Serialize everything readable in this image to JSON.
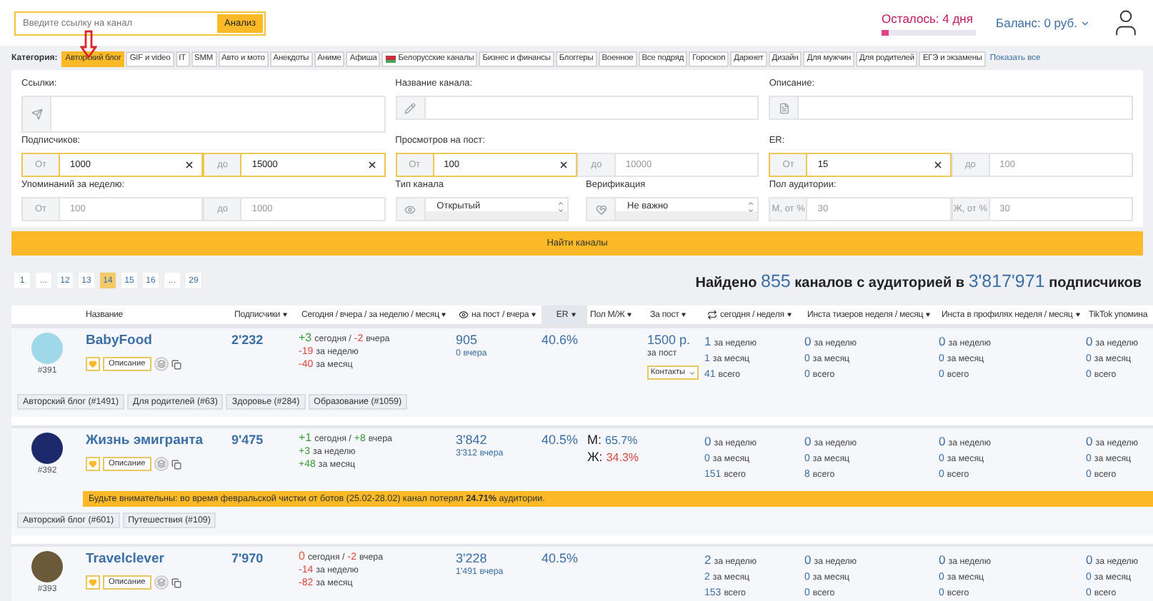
{
  "search": {
    "placeholder": "Введите ссылку на канал",
    "button": "Анализ"
  },
  "trial": {
    "label": "Осталось: 4 дня",
    "level": 0.08
  },
  "balance": {
    "label": "Баланс: 0 руб."
  },
  "categories": {
    "label": "Категория:",
    "show_all": "Показать все",
    "items": [
      {
        "label": "Авторский блог",
        "selected": true,
        "kind": "plain"
      },
      {
        "label": "GIF и video",
        "selected": false,
        "kind": "plain"
      },
      {
        "label": "IT",
        "selected": false,
        "kind": "plain"
      },
      {
        "label": "SMM",
        "selected": false,
        "kind": "plain"
      },
      {
        "label": "Авто и мото",
        "selected": false,
        "kind": "plain"
      },
      {
        "label": "Анекдоты",
        "selected": false,
        "kind": "plain"
      },
      {
        "label": "Аниме",
        "selected": false,
        "kind": "plain"
      },
      {
        "label": "Афиша",
        "selected": false,
        "kind": "plain"
      },
      {
        "label": "Белорусские каналы",
        "selected": false,
        "kind": "flag"
      },
      {
        "label": "Бизнес и финансы",
        "selected": false,
        "kind": "plain"
      },
      {
        "label": "Блоггеры",
        "selected": false,
        "kind": "plain"
      },
      {
        "label": "Военное",
        "selected": false,
        "kind": "plain"
      },
      {
        "label": "Все подряд",
        "selected": false,
        "kind": "plain"
      },
      {
        "label": "Гороскоп",
        "selected": false,
        "kind": "plain"
      },
      {
        "label": "Даркнет",
        "selected": false,
        "kind": "plain"
      },
      {
        "label": "Дизайн",
        "selected": false,
        "kind": "plain"
      },
      {
        "label": "Для мужчин",
        "selected": false,
        "kind": "plain"
      },
      {
        "label": "Для родителей",
        "selected": false,
        "kind": "plain"
      },
      {
        "label": "ЕГЭ и экзамены",
        "selected": false,
        "kind": "plain"
      }
    ]
  },
  "filters": {
    "links": {
      "label": "Ссылки:"
    },
    "channel_name": {
      "label": "Название канала:"
    },
    "description": {
      "label": "Описание:"
    },
    "subscribers": {
      "label": "Подписчиков:",
      "from": {
        "prefix": "От",
        "value": "1000"
      },
      "to": {
        "prefix": "до",
        "value": "15000"
      }
    },
    "views_per_post": {
      "label": "Просмотров на пост:",
      "from": {
        "prefix": "От",
        "value": "100"
      },
      "to": {
        "prefix": "до",
        "placeholder": "10000"
      }
    },
    "er": {
      "label": "ER:",
      "from": {
        "prefix": "От",
        "value": "15"
      },
      "to": {
        "prefix": "до",
        "placeholder": "100"
      }
    },
    "mentions": {
      "label": "Упоминаний за неделю:",
      "from": {
        "prefix": "От",
        "placeholder": "100"
      },
      "to": {
        "prefix": "до",
        "placeholder": "1000"
      }
    },
    "channel_type": {
      "label": "Тип канала",
      "value": "Открытый"
    },
    "verification": {
      "label": "Верификация",
      "value": "Не важно"
    },
    "audience_gender": {
      "label": "Пол аудитории:",
      "from": {
        "prefix": "М, от %",
        "placeholder": "30"
      },
      "to": {
        "prefix": "Ж, от %",
        "placeholder": "30"
      }
    }
  },
  "search_button": "Найти каналы",
  "pagination": [
    {
      "label": "1",
      "selected": false
    },
    {
      "label": "...",
      "selected": false
    },
    {
      "label": "12",
      "selected": false
    },
    {
      "label": "13",
      "selected": false
    },
    {
      "label": "14",
      "selected": true
    },
    {
      "label": "15",
      "selected": false
    },
    {
      "label": "16",
      "selected": false
    },
    {
      "label": "...",
      "selected": false
    },
    {
      "label": "29",
      "selected": false
    }
  ],
  "summary": {
    "prefix": "Найдено",
    "count": "855",
    "middle": "каналов с аудиторией в",
    "total": "3'817'971",
    "suffix": "подписчиков"
  },
  "table": {
    "columns": [
      {
        "label": "Название",
        "sortable": false,
        "selected": false,
        "kind": "plain"
      },
      {
        "label": "Подписчики",
        "sortable": true,
        "selected": false,
        "kind": "plain"
      },
      {
        "label": "Сегодня / вчера / за неделю / месяц",
        "sortable": true,
        "selected": false,
        "kind": "plain"
      },
      {
        "label": "на пост / вчера",
        "sortable": true,
        "selected": false,
        "kind": "eye"
      },
      {
        "label": "ER",
        "sortable": true,
        "selected": true,
        "kind": "plain"
      },
      {
        "label": "Пол М/Ж",
        "sortable": true,
        "selected": false,
        "kind": "plain"
      },
      {
        "label": "За пост",
        "sortable": true,
        "selected": false,
        "kind": "plain"
      },
      {
        "label": "сегодня / неделя",
        "sortable": true,
        "selected": false,
        "kind": "repost"
      },
      {
        "label": "Инста тизеров неделя / месяц",
        "sortable": true,
        "selected": false,
        "kind": "plain"
      },
      {
        "label": "Инста в профилях неделя / месяц",
        "sortable": true,
        "selected": false,
        "kind": "plain"
      },
      {
        "label": "TikTok упомина",
        "sortable": false,
        "selected": false,
        "kind": "plain"
      }
    ],
    "rows": [
      {
        "rank": "#391",
        "name": "BabyFood",
        "subscribers": "2'232",
        "today": {
          "value": "+3",
          "color": "#3a9a3a",
          "label": "сегодня /"
        },
        "yesterday": {
          "value": "-2",
          "color": "#d9443c",
          "label": "вчера"
        },
        "week": {
          "value": "-19",
          "color": "#d9443c",
          "label": "за неделю"
        },
        "month": {
          "value": "-40",
          "color": "#d9443c",
          "label": "за месяц"
        },
        "views": "905",
        "views_yesterday": {
          "value": "0",
          "label": "вчера"
        },
        "er": "40.6%",
        "price": {
          "value": "1500 р.",
          "label": "за пост",
          "button": "Контакты"
        },
        "description_button": "Описание",
        "stats": [
          [
            {
              "count": "1",
              "period": "за неделю"
            },
            {
              "count": "1",
              "period": "за месяц"
            },
            {
              "count": "41",
              "period": "всего"
            }
          ],
          [
            {
              "count": "0",
              "period": "за неделю"
            },
            {
              "count": "0",
              "period": "за месяц"
            },
            {
              "count": "0",
              "period": "всего"
            }
          ],
          [
            {
              "count": "0",
              "period": "за неделю"
            },
            {
              "count": "0",
              "period": "за месяц"
            },
            {
              "count": "0",
              "period": "всего"
            }
          ],
          [
            {
              "count": "0",
              "period": "за неделю"
            },
            {
              "count": "0",
              "period": "за месяц"
            },
            {
              "count": "0",
              "period": "всего"
            }
          ]
        ],
        "tags": [
          "Авторский блог (#1491)",
          "Для родителей (#63)",
          "Здоровье (#284)",
          "Образование (#1059)"
        ]
      },
      {
        "rank": "#392",
        "name": "Жизнь эмигранта",
        "subscribers": "9'475",
        "today": {
          "value": "+1",
          "color": "#3a9a3a",
          "label": "сегодня /"
        },
        "yesterday": {
          "value": "+8",
          "color": "#3a9a3a",
          "label": "вчера"
        },
        "week": {
          "value": "+3",
          "color": "#3a9a3a",
          "label": "за неделю"
        },
        "month": {
          "value": "+48",
          "color": "#3a9a3a",
          "label": "за месяц"
        },
        "views": "3'842",
        "views_yesterday": {
          "value": "3'312",
          "label": "вчера"
        },
        "er": "40.5%",
        "gender": {
          "male": {
            "prefix": "М:",
            "value": "65.7%"
          },
          "female": {
            "prefix": "Ж:",
            "value": "34.3%"
          }
        },
        "description_button": "Описание",
        "stats": [
          [
            {
              "count": "0",
              "period": "за неделю"
            },
            {
              "count": "0",
              "period": "за месяц"
            },
            {
              "count": "151",
              "period": "всего"
            }
          ],
          [
            {
              "count": "0",
              "period": "за неделю"
            },
            {
              "count": "0",
              "period": "за месяц"
            },
            {
              "count": "8",
              "period": "всего"
            }
          ],
          [
            {
              "count": "0",
              "period": "за неделю"
            },
            {
              "count": "0",
              "period": "за месяц"
            },
            {
              "count": "0",
              "period": "всего"
            }
          ],
          [
            {
              "count": "0",
              "period": "за неделю"
            },
            {
              "count": "0",
              "period": "за месяц"
            },
            {
              "count": "0",
              "period": "всего"
            }
          ]
        ],
        "warning": "Будьте внимательны: во время февральской чистки от ботов (25.02-28.02) канал потерял **24.71%** аудитории.",
        "tags": [
          "Авторский блог (#601)",
          "Путешествия (#109)"
        ]
      },
      {
        "rank": "#393",
        "name": "Travelclever",
        "subscribers": "7'970",
        "today": {
          "value": "0",
          "color": "#e0603a",
          "label": "сегодня /"
        },
        "yesterday": {
          "value": "-2",
          "color": "#d9443c",
          "label": "вчера"
        },
        "week": {
          "value": "-14",
          "color": "#d9443c",
          "label": "за неделю"
        },
        "month": {
          "value": "-82",
          "color": "#d9443c",
          "label": "за месяц"
        },
        "views": "3'228",
        "views_yesterday": {
          "value": "1'491",
          "label": "вчера"
        },
        "er": "40.5%",
        "description_button": "Описание",
        "stats": [
          [
            {
              "count": "2",
              "period": "за неделю"
            },
            {
              "count": "2",
              "period": "за месяц"
            },
            {
              "count": "153",
              "period": "всего"
            }
          ],
          [
            {
              "count": "0",
              "period": "за неделю"
            },
            {
              "count": "0",
              "period": "за месяц"
            },
            {
              "count": "0",
              "period": "всего"
            }
          ],
          [
            {
              "count": "0",
              "period": "за неделю"
            },
            {
              "count": "0",
              "period": "за месяц"
            },
            {
              "count": "0",
              "period": "всего"
            }
          ],
          [
            {
              "count": "0",
              "period": "за неделю"
            },
            {
              "count": "0",
              "period": "за месяц"
            },
            {
              "count": "0",
              "period": "всего"
            }
          ]
        ]
      }
    ]
  }
}
